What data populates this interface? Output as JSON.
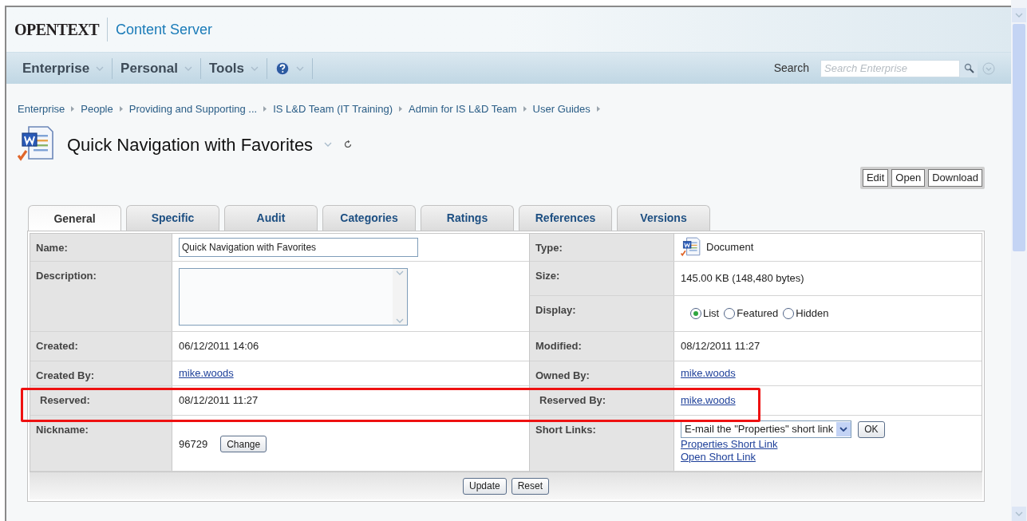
{
  "header": {
    "logo": "OPENTEXT",
    "product": "Content Server"
  },
  "nav": {
    "menus": [
      {
        "kind": "menu",
        "label": "Enterprise"
      },
      {
        "kind": "menu",
        "label": "Personal"
      },
      {
        "kind": "menu",
        "label": "Tools"
      },
      {
        "kind": "help"
      }
    ],
    "search_label": "Search",
    "search": {
      "placeholder": "Search Enterprise"
    }
  },
  "breadcrumbs": [
    "Enterprise",
    "People",
    "Providing and Supporting ...",
    "IS L&D Team (IT Training)",
    "Admin for IS L&D Team",
    "User Guides"
  ],
  "title": "Quick Navigation with Favorites",
  "actions": [
    "Edit",
    "Open",
    "Download"
  ],
  "tabs": [
    {
      "label": "General",
      "selected": true
    },
    {
      "label": "Specific",
      "selected": false
    },
    {
      "label": "Audit",
      "selected": false
    },
    {
      "label": "Categories",
      "selected": false
    },
    {
      "label": "Ratings",
      "selected": false
    },
    {
      "label": "References",
      "selected": false
    },
    {
      "label": "Versions",
      "selected": false
    }
  ],
  "left_fields": [
    {
      "kind": "input",
      "label": "Name:",
      "value": "Quick Navigation with Favorites"
    },
    {
      "kind": "textarea",
      "label": "Description:"
    },
    {
      "kind": "text",
      "label": "Created:",
      "value": "06/12/2011 14:06"
    },
    {
      "kind": "link",
      "label": "Created By:",
      "value": "mike.woods"
    },
    {
      "kind": "text",
      "label": "Reserved:",
      "value": "08/12/2011 11:27",
      "highlighted": true
    },
    {
      "kind": "nickname",
      "label": "Nickname:",
      "value": "96729",
      "button": "Change"
    }
  ],
  "right_fields": [
    {
      "kind": "type",
      "label": "Type:",
      "value": "Document"
    },
    {
      "kind": "text",
      "label": "Size:",
      "value": "145.00 KB (148,480 bytes)"
    },
    {
      "kind": "radio",
      "label": "Display:",
      "options": [
        {
          "label": "List",
          "selected": true
        },
        {
          "label": "Featured",
          "selected": false
        },
        {
          "label": "Hidden",
          "selected": false
        }
      ]
    },
    {
      "kind": "text",
      "label": "Modified:",
      "value": "08/12/2011 11:27"
    },
    {
      "kind": "link",
      "label": "Owned By:",
      "value": "mike.woods"
    },
    {
      "kind": "link",
      "label": "Reserved By:",
      "value": "mike.woods",
      "highlighted": true
    },
    {
      "kind": "shortlinks",
      "label": "Short Links:",
      "select": "E-mail the \"Properties\" short link",
      "button": "OK",
      "links": [
        "Properties Short Link",
        "Open Short Link"
      ]
    }
  ],
  "footer_buttons": [
    "Update",
    "Reset"
  ]
}
